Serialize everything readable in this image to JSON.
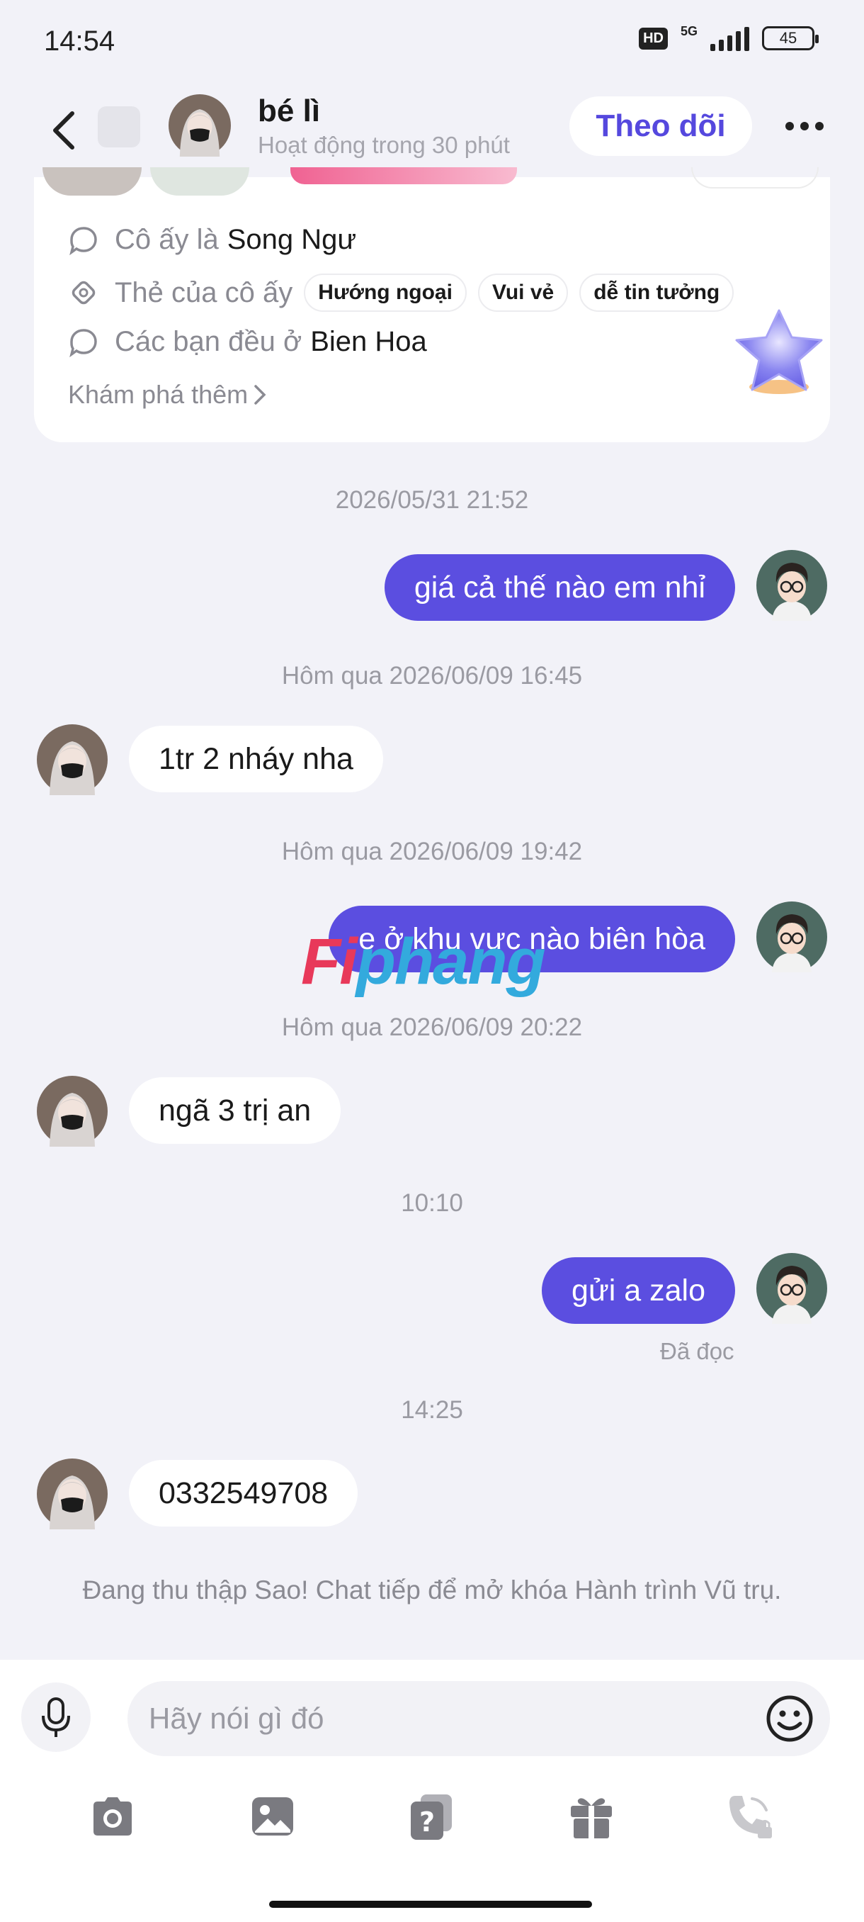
{
  "status_bar": {
    "time": "14:54",
    "hd": "HD",
    "network": "5G",
    "battery": "45"
  },
  "header": {
    "name": "bé lì",
    "activity": "Hoạt động trong 30 phút",
    "follow_label": "Theo dõi"
  },
  "profile_card": {
    "zodiac_label": "Cô ấy là",
    "zodiac_value": "Song Ngư",
    "tags_label": "Thẻ của cô ấy",
    "tags": [
      "Hướng ngoại",
      "Vui vẻ",
      "dễ tin tưởng"
    ],
    "location_label": "Các bạn đều ở",
    "location_value": "Bien Hoa",
    "explore_label": "Khám phá thêm"
  },
  "chat": {
    "ts1": "2026/05/31 21:52",
    "msg1": "giá cả thế nào em nhỉ",
    "ts2": "Hôm qua 2026/06/09 16:45",
    "msg2": "1tr 2 nháy nha",
    "ts3": "Hôm qua 2026/06/09 19:42",
    "msg3": "e ở khu vực nào biên hòa",
    "ts4": "Hôm qua 2026/06/09 20:22",
    "msg4": "ngã 3 trị an",
    "ts5": "10:10",
    "msg5": "gửi a zalo",
    "read_status": "Đã đọc",
    "ts6": "14:25",
    "msg6": "0332549708",
    "notice": "Đang thu thập Sao! Chat tiếp để mở khóa Hành trình Vũ trụ."
  },
  "watermark": {
    "part1": "Fi",
    "part2": "phang"
  },
  "input": {
    "placeholder": "Hãy nói gì đó"
  },
  "colors": {
    "accent": "#5b4ee0",
    "background": "#f2f2f8"
  },
  "icons": [
    "back-icon",
    "more-icon",
    "mic-icon",
    "emoji-icon",
    "camera-icon",
    "gallery-icon",
    "question-card-icon",
    "gift-icon",
    "call-locked-icon"
  ]
}
